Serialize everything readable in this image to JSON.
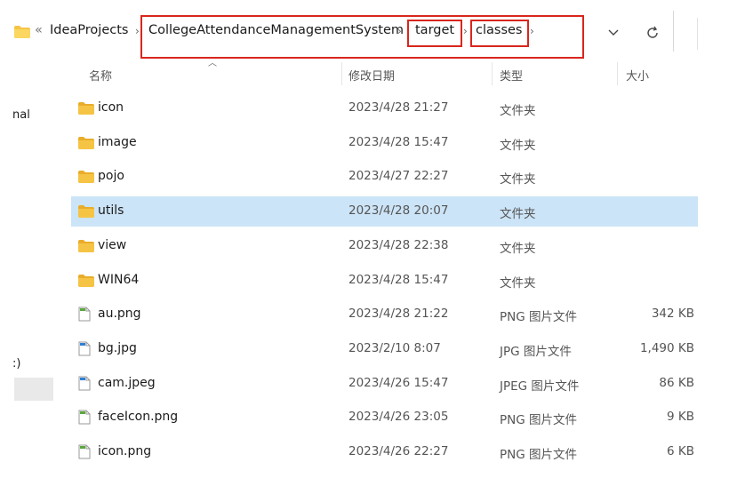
{
  "breadcrumbs": {
    "overflow": "«",
    "items": [
      "IdeaProjects",
      "CollegeAttendanceManagementSystem",
      "target",
      "classes"
    ]
  },
  "toolbar": {
    "dropdown_icon": "chevron-down-icon",
    "refresh_icon": "refresh-icon"
  },
  "columns": {
    "name": "名称",
    "modified": "修改日期",
    "type": "类型",
    "size": "大小"
  },
  "sidebar": {
    "fragment_top": "nal",
    "fragment_bottom": ":)"
  },
  "colors": {
    "highlight": "#d9261c",
    "selection": "#cce4f7",
    "folder": "#f6c445"
  },
  "rows": [
    {
      "name": "icon",
      "modified": "2023/4/28 21:27",
      "type": "文件夹",
      "size": "",
      "kind": "folder",
      "selected": false
    },
    {
      "name": "image",
      "modified": "2023/4/28 15:47",
      "type": "文件夹",
      "size": "",
      "kind": "folder",
      "selected": false
    },
    {
      "name": "pojo",
      "modified": "2023/4/27 22:27",
      "type": "文件夹",
      "size": "",
      "kind": "folder",
      "selected": false
    },
    {
      "name": "utils",
      "modified": "2023/4/28 20:07",
      "type": "文件夹",
      "size": "",
      "kind": "folder",
      "selected": true
    },
    {
      "name": "view",
      "modified": "2023/4/28 22:38",
      "type": "文件夹",
      "size": "",
      "kind": "folder",
      "selected": false
    },
    {
      "name": "WIN64",
      "modified": "2023/4/28 15:47",
      "type": "文件夹",
      "size": "",
      "kind": "folder",
      "selected": false
    },
    {
      "name": "au.png",
      "modified": "2023/4/28 21:22",
      "type": "PNG 图片文件",
      "size": "342 KB",
      "kind": "png",
      "selected": false
    },
    {
      "name": "bg.jpg",
      "modified": "2023/2/10 8:07",
      "type": "JPG 图片文件",
      "size": "1,490 KB",
      "kind": "jpg",
      "selected": false
    },
    {
      "name": "cam.jpeg",
      "modified": "2023/4/26 15:47",
      "type": "JPEG 图片文件",
      "size": "86 KB",
      "kind": "jpg",
      "selected": false
    },
    {
      "name": "faceIcon.png",
      "modified": "2023/4/26 23:05",
      "type": "PNG 图片文件",
      "size": "9 KB",
      "kind": "png",
      "selected": false
    },
    {
      "name": "icon.png",
      "modified": "2023/4/26 22:27",
      "type": "PNG 图片文件",
      "size": "6 KB",
      "kind": "png",
      "selected": false
    }
  ]
}
